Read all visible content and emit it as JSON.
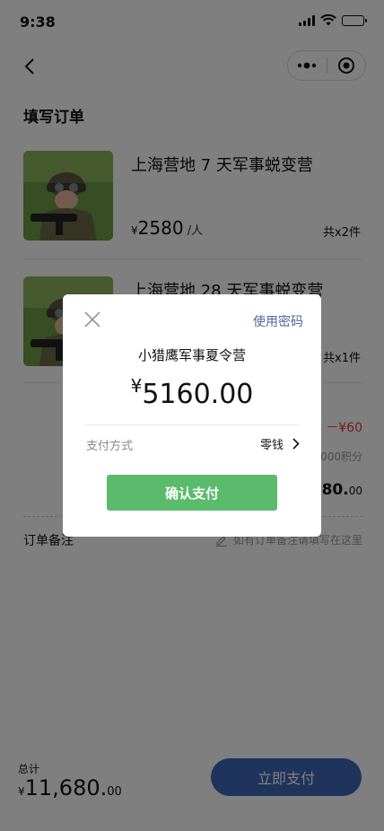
{
  "status": {
    "time": "9:38"
  },
  "page": {
    "title": "填写订单"
  },
  "items": [
    {
      "name": "上海营地 7 天军事蜕变营",
      "currency": "¥",
      "price": "2580",
      "unit": "/人",
      "qty": "共x2件"
    },
    {
      "name": "上海营地 28 天军事蜕变营",
      "qty": "共x1件"
    }
  ],
  "summary": {
    "discount": "－¥60",
    "points_note": "000积分",
    "subtotal_int": "680.",
    "subtotal_dec": "00"
  },
  "remark": {
    "label": "订单备注",
    "hint": "如有订单备注请填写在这里"
  },
  "footer": {
    "total_label": "总计",
    "currency": "¥",
    "total_int": "11,680.",
    "total_dec": "00",
    "pay_button": "立即支付"
  },
  "dialog": {
    "use_password": "使用密码",
    "merchant": "小猎鹰军事夏令营",
    "currency": "¥",
    "amount": "5160.00",
    "method_label": "支付方式",
    "method_value": "零钱",
    "confirm": "确认支付"
  },
  "colors": {
    "primary": "#3f68b8",
    "confirm_green": "#5bbb6c",
    "discount_red": "#e03a3a",
    "link_blue": "#4a6a9a"
  }
}
